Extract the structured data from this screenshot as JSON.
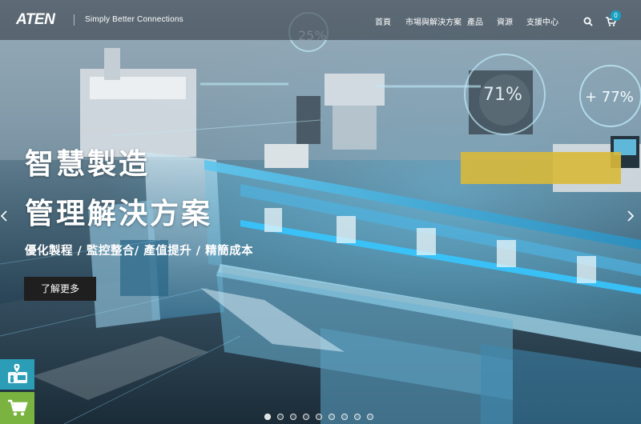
{
  "header": {
    "logo_text": "ATEN",
    "tagline": "Simply Better Connections",
    "nav": [
      "首頁",
      "市場與解決方案",
      "產品",
      "資源",
      "支援中心"
    ],
    "cart_count": "0",
    "icons": [
      "search-icon",
      "cart-icon"
    ]
  },
  "slide": {
    "headline_1": "智慧製造",
    "headline_2": "管理解決方案",
    "subtitle": "優化製程 / 監控整合/ 產值提升 / 精簡成本",
    "cta_label": "了解更多",
    "hud_left": "25%",
    "hud_mid": "71%",
    "hud_right": "+ 77%"
  },
  "carousel": {
    "dot_count": 9,
    "active_dot": 0,
    "prev_icon": "chevron-left-icon",
    "next_icon": "chevron-right-icon"
  },
  "side_buttons": [
    "store-locator-icon",
    "shopping-cart-icon"
  ],
  "colors": {
    "accent": "#17a0c4",
    "locator_bg": "#2b9db7",
    "shop_bg": "#7bb341",
    "cta_bg": "#1f1f1f"
  }
}
